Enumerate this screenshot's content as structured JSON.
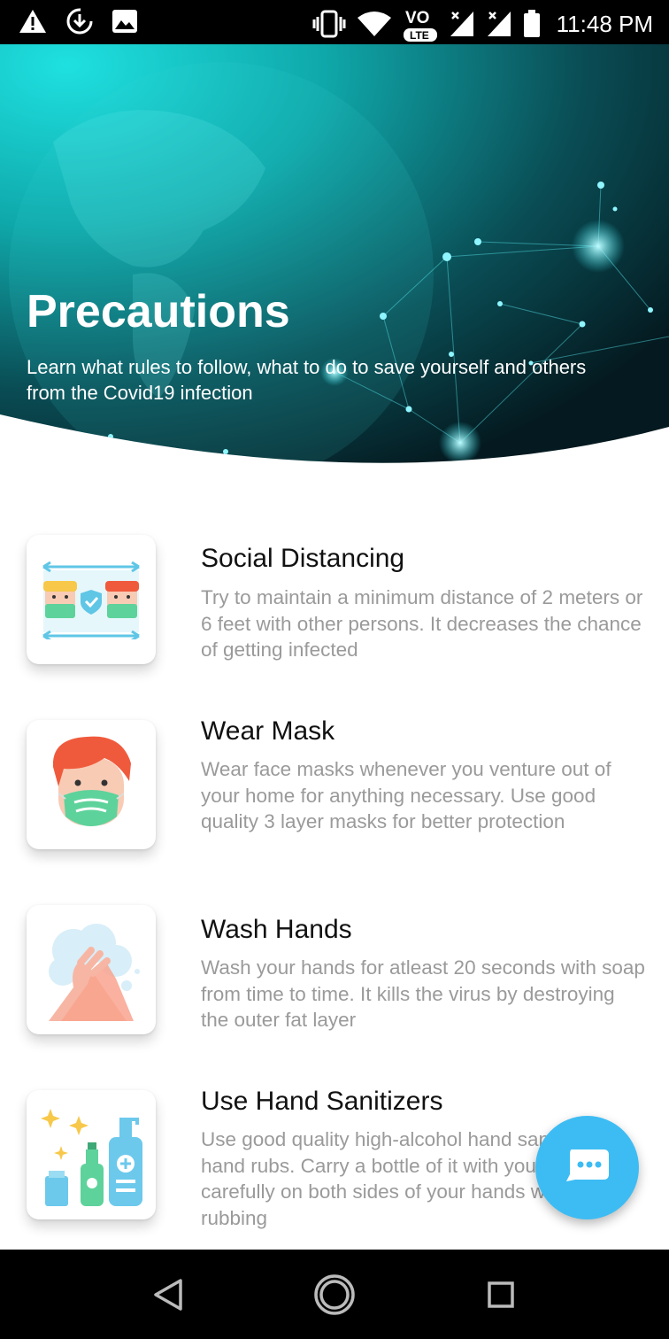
{
  "status_bar": {
    "time": "11:48 PM",
    "left_icons": [
      "warning-icon",
      "download-icon",
      "image-icon"
    ],
    "right_icons": [
      "vibrate-icon",
      "wifi-icon",
      "volte-icon",
      "signal-icon",
      "signal-icon",
      "battery-icon"
    ],
    "volte_text": "VO",
    "lte_text": "LTE"
  },
  "hero": {
    "title": "Precautions",
    "subtitle": "Learn what rules to follow, what to do to save yourself and others from the Covid19 infection"
  },
  "precautions": [
    {
      "title": "Social Distancing",
      "description": "Try to maintain a minimum distance of 2 meters or 6 feet with other persons. It decreases the chance of getting infected",
      "icon": "social-distancing-icon"
    },
    {
      "title": "Wear Mask",
      "description": "Wear face masks whenever you venture out of your home for anything necessary. Use good quality 3 layer masks for better protection",
      "icon": "face-mask-icon"
    },
    {
      "title": "Wash Hands",
      "description": "Wash your hands for atleast 20 seconds with soap from time to time. It kills the virus by destroying the outer fat layer",
      "icon": "wash-hands-icon"
    },
    {
      "title": "Use Hand Sanitizers",
      "description": "Use good quality high-alcohol hand sanitizers or hand rubs. Carry a bottle of it with you. Apply carefully on both sides of your hands when rubbing",
      "icon": "hand-sanitizer-icon"
    }
  ],
  "fab": {
    "icon": "chat-icon"
  },
  "nav_bar": {
    "icons": [
      "back-icon",
      "home-icon",
      "recents-icon"
    ]
  },
  "colors": {
    "accent": "#3dbcf3",
    "hero_teal": "#12b8b8",
    "text_primary": "#111111",
    "text_secondary": "#9a9a9a"
  }
}
